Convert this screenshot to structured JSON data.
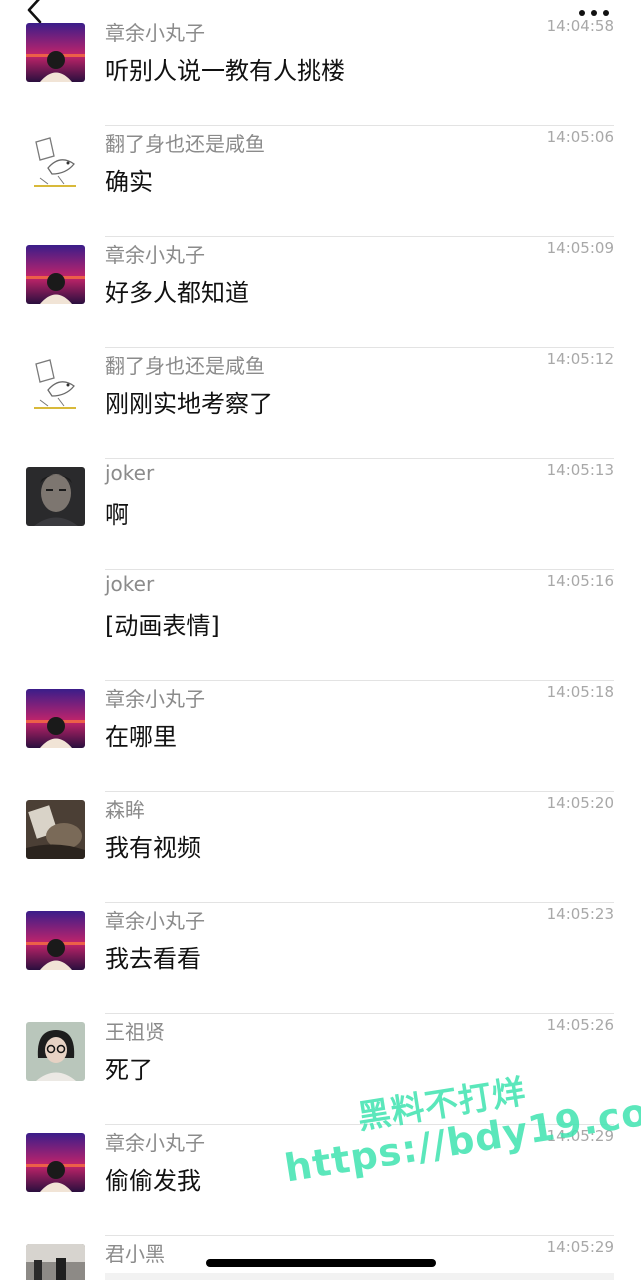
{
  "header": {
    "back_icon": "chevron-left-icon",
    "more_icon": "ellipsis-icon"
  },
  "messages": [
    {
      "sender": "章余小丸子",
      "time": "14:04:58",
      "text": "听别人说一教有人挑楼",
      "avatar": "sunset-city-avatar"
    },
    {
      "sender": "翻了身也还是咸鱼",
      "time": "14:05:06",
      "text": "确实",
      "avatar": "fish-sketch-avatar"
    },
    {
      "sender": "章余小丸子",
      "time": "14:05:09",
      "text": "好多人都知道",
      "avatar": "sunset-city-avatar"
    },
    {
      "sender": "翻了身也还是咸鱼",
      "time": "14:05:12",
      "text": "刚刚实地考察了",
      "avatar": "fish-sketch-avatar"
    },
    {
      "sender": "joker",
      "time": "14:05:13",
      "text": "啊",
      "avatar": "dark-portrait-avatar"
    },
    {
      "sender": "joker",
      "time": "14:05:16",
      "text": "[动画表情]",
      "avatar": ""
    },
    {
      "sender": "章余小丸子",
      "time": "14:05:18",
      "text": "在哪里",
      "avatar": "sunset-city-avatar"
    },
    {
      "sender": "森眸",
      "time": "14:05:20",
      "text": "我有视频",
      "avatar": "cat-photo-avatar"
    },
    {
      "sender": "章余小丸子",
      "time": "14:05:23",
      "text": "我去看看",
      "avatar": "sunset-city-avatar"
    },
    {
      "sender": "王祖贤",
      "time": "14:05:26",
      "text": "死了",
      "avatar": "woman-portrait-avatar"
    },
    {
      "sender": "章余小丸子",
      "time": "14:05:29",
      "text": "偷偷发我",
      "avatar": "sunset-city-avatar"
    },
    {
      "sender": "君小黑",
      "time": "14:05:29",
      "text": "",
      "avatar": "street-photo-avatar"
    }
  ],
  "watermark": {
    "line1": "黑料不打烊",
    "line2": "https://bdy19.co"
  }
}
